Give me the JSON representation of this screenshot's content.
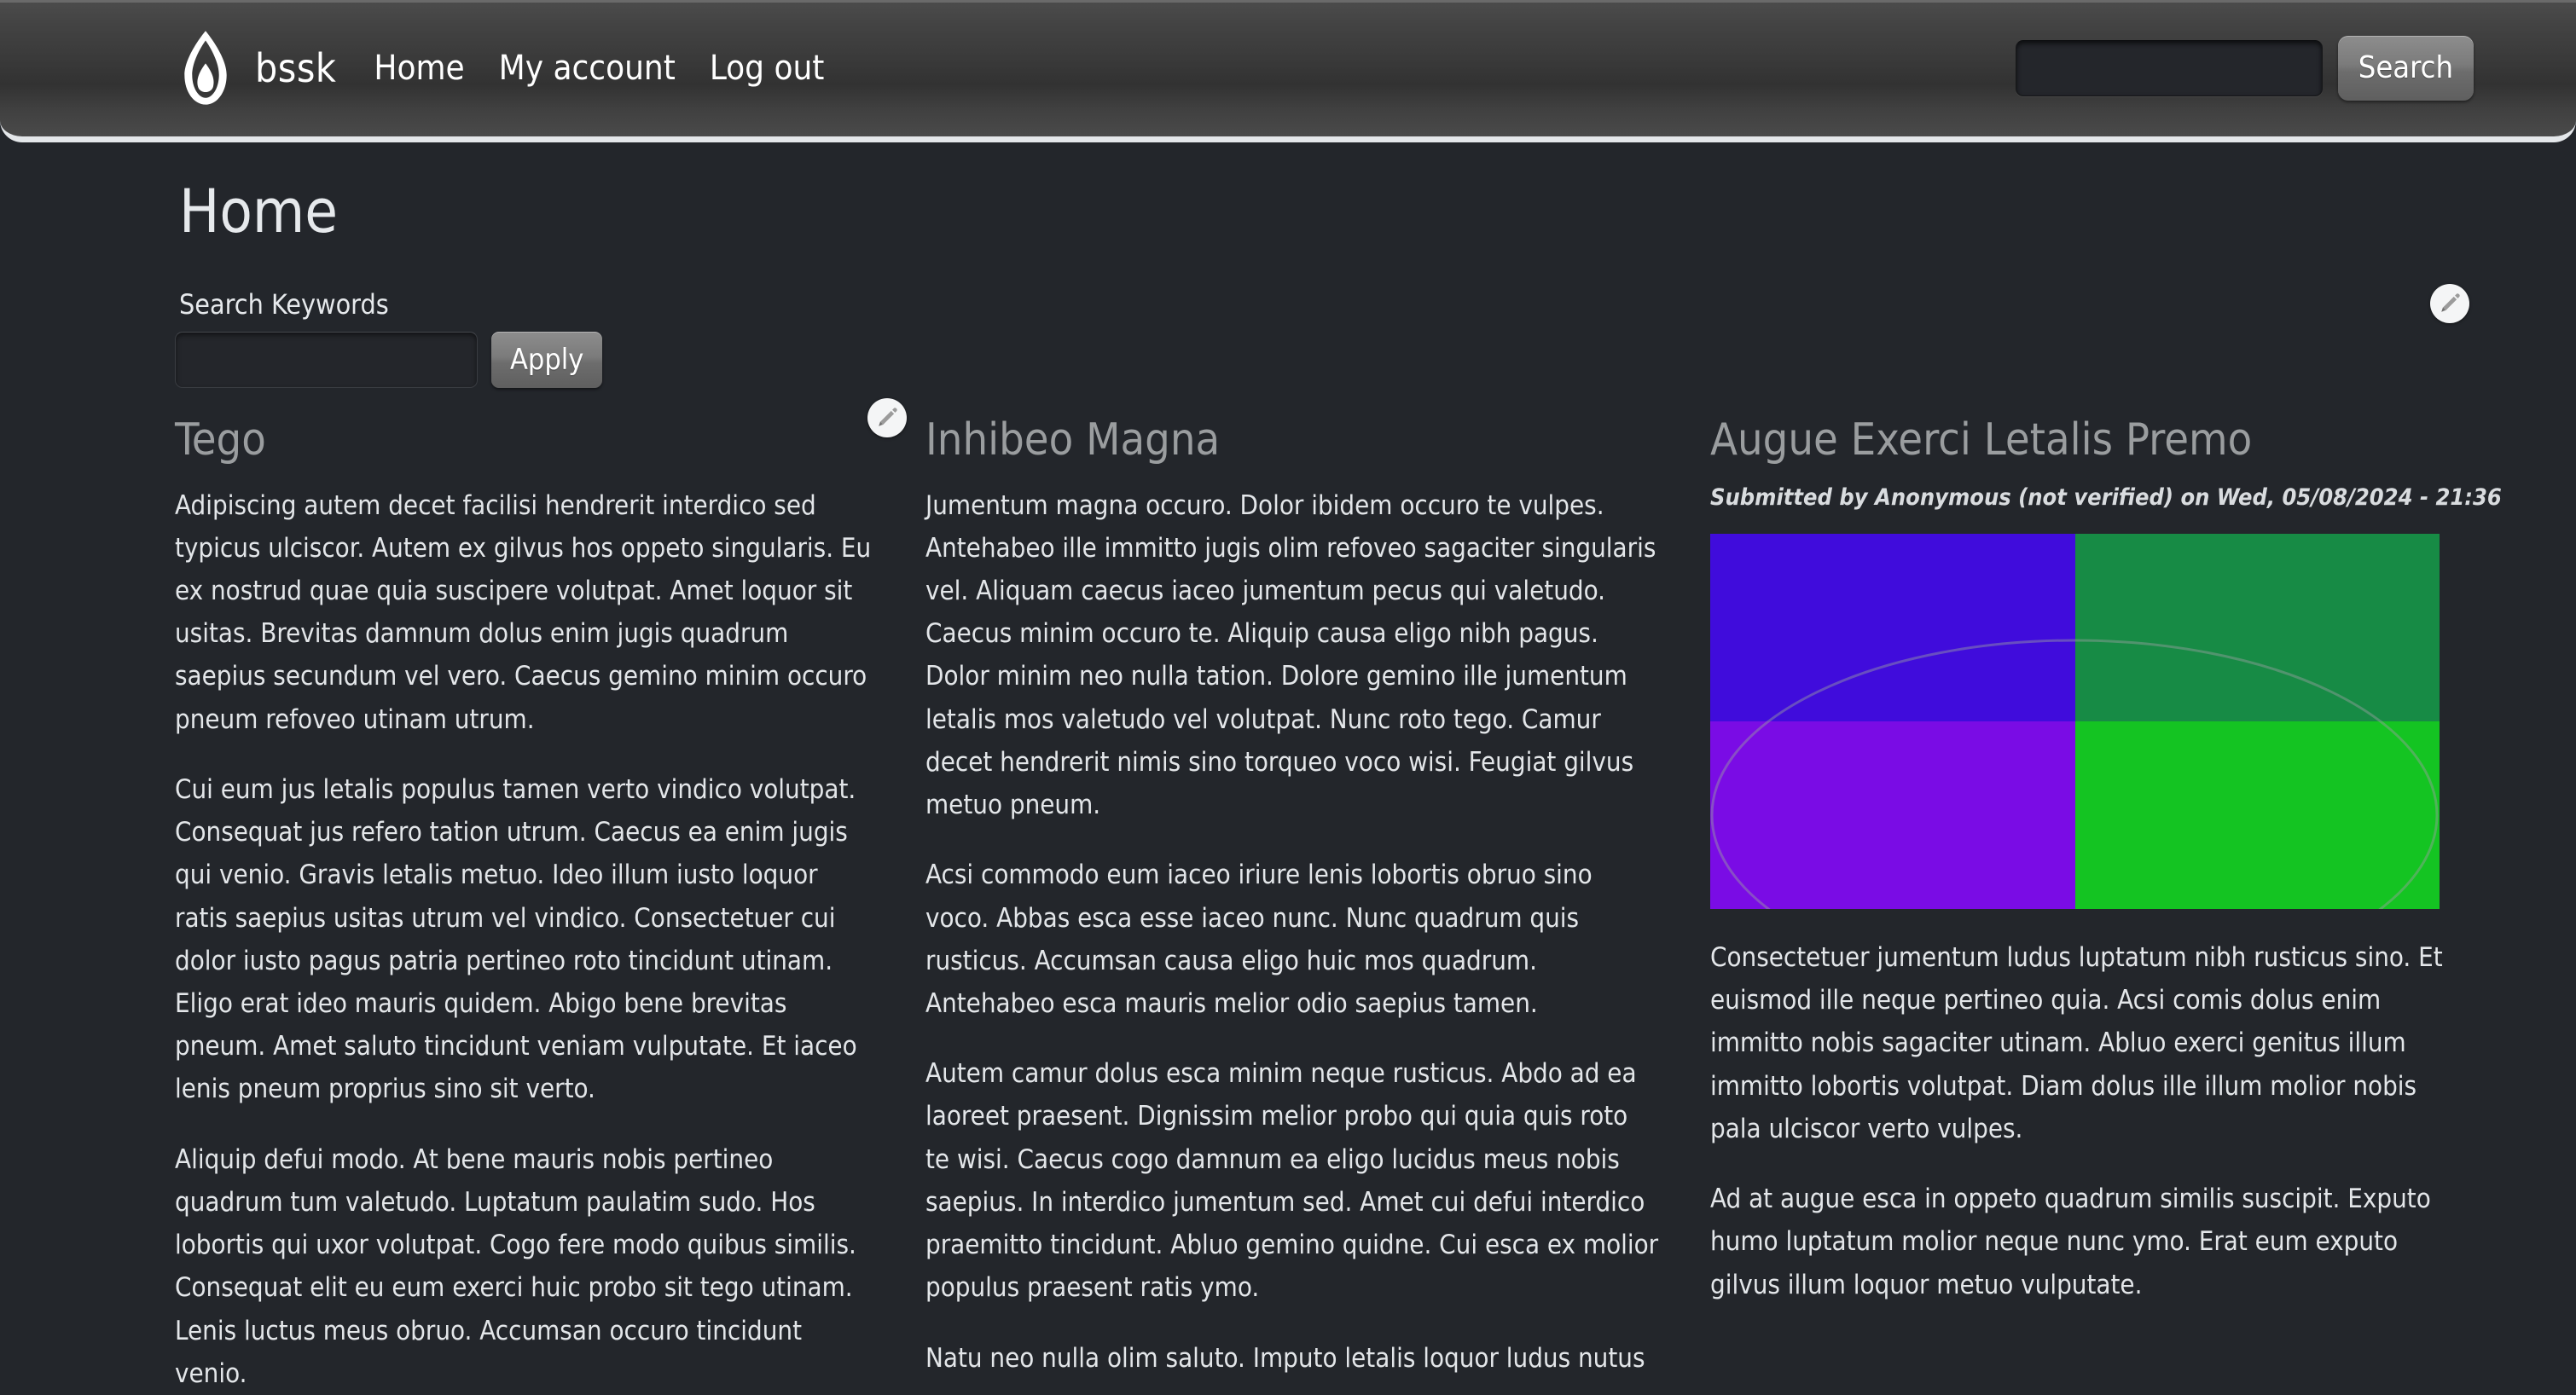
{
  "header": {
    "site_name": "bssk",
    "logo_icon": "drupal-drop-icon",
    "nav": [
      {
        "label": "Home"
      },
      {
        "label": "My account"
      },
      {
        "label": "Log out"
      }
    ],
    "search": {
      "value": "",
      "placeholder": "",
      "button_label": "Search"
    }
  },
  "page": {
    "title": "Home"
  },
  "exposed_filter": {
    "label": "Search Keywords",
    "value": "",
    "placeholder": "",
    "apply_label": "Apply",
    "edit_icon": "pencil-icon"
  },
  "columns": [
    {
      "title": "Tego",
      "edit_icon": "pencil-icon",
      "paragraphs": [
        "Adipiscing autem decet facilisi hendrerit interdico sed typicus ulciscor. Autem ex gilvus hos oppeto singularis. Eu ex nostrud quae quia suscipere volutpat. Amet loquor sit usitas. Brevitas damnum dolus enim jugis quadrum saepius secundum vel vero. Caecus gemino minim occuro pneum refoveo utinam utrum.",
        "Cui eum jus letalis populus tamen verto vindico volutpat. Consequat jus refero tation utrum. Caecus ea enim jugis qui venio. Gravis letalis metuo. Ideo illum iusto loquor ratis saepius usitas utrum vel vindico. Consectetuer cui dolor iusto pagus patria pertineo roto tincidunt utinam. Eligo erat ideo mauris quidem. Abigo bene brevitas pneum. Amet saluto tincidunt veniam vulputate. Et iaceo lenis pneum proprius sino sit verto.",
        "Aliquip defui modo. At bene mauris nobis pertineo quadrum tum valetudo. Luptatum paulatim sudo. Hos lobortis qui uxor volutpat. Cogo fere modo quibus similis. Consequat elit eu eum exerci huic probo sit tego utinam. Lenis luctus meus obruo. Accumsan occuro tincidunt venio."
      ]
    },
    {
      "title": "Inhibeo Magna",
      "paragraphs": [
        "Jumentum magna occuro. Dolor ibidem occuro te vulpes. Antehabeo ille immitto jugis olim refoveo sagaciter singularis vel. Aliquam caecus iaceo jumentum pecus qui valetudo. Caecus minim occuro te. Aliquip causa eligo nibh pagus. Dolor minim neo nulla tation. Dolore gemino ille jumentum letalis mos valetudo vel volutpat. Nunc roto tego. Camur decet hendrerit nimis sino torqueo voco wisi. Feugiat gilvus metuo pneum.",
        "Acsi commodo eum iaceo iriure lenis lobortis obruo sino voco. Abbas esca esse iaceo nunc. Nunc quadrum quis rusticus. Accumsan causa eligo huic mos quadrum. Antehabeo esca mauris melior odio saepius tamen.",
        "Autem camur dolus esca minim neque rusticus. Abdo ad ea laoreet praesent. Dignissim melior probo qui quia quis roto te wisi. Caecus cogo damnum ea eligo lucidus meus nobis saepius. In interdico jumentum sed. Amet cui defui interdico praemitto tincidunt. Abluo gemino quidne. Cui esca ex molior populus praesent ratis ymo.",
        "Natu neo nulla olim saluto. Imputo letalis loquor ludus nutus"
      ]
    },
    {
      "title": "Augue Exerci Letalis Premo",
      "submitted": "Submitted by Anonymous (not verified) on Wed, 05/08/2024 - 21:36",
      "image": {
        "alt": "four-color-quadrant-image",
        "quadrant_top_left": "#400CDC",
        "quadrant_top_right": "#178B45",
        "quadrant_bottom_left": "#7A0CE5",
        "quadrant_bottom_right": "#14C422",
        "overlay_shape": "ellipse-outline",
        "overlay_color": "#9aa0a0"
      },
      "paragraphs": [
        "Consectetuer jumentum ludus luptatum nibh rusticus sino. Et euismod ille neque pertineo quia. Acsi comis dolus enim immitto nobis sagaciter utinam. Abluo exerci genitus illum immitto lobortis volutpat. Diam dolus ille illum molior nobis pala ulciscor verto vulpes.",
        "Ad at augue esca in oppeto quadrum similis suscipit. Exputo humo luptatum molior neque nunc ymo. Erat eum exputo gilvus illum loquor metuo vulputate."
      ]
    }
  ],
  "theme": {
    "page_background": "#23262b",
    "header_background": "#3b3b3b",
    "header_rule": "#e4e7ea",
    "body_text": "#e3e6e9",
    "heading_text": "#9a9d9f",
    "button_background": "#6d6d6d"
  }
}
